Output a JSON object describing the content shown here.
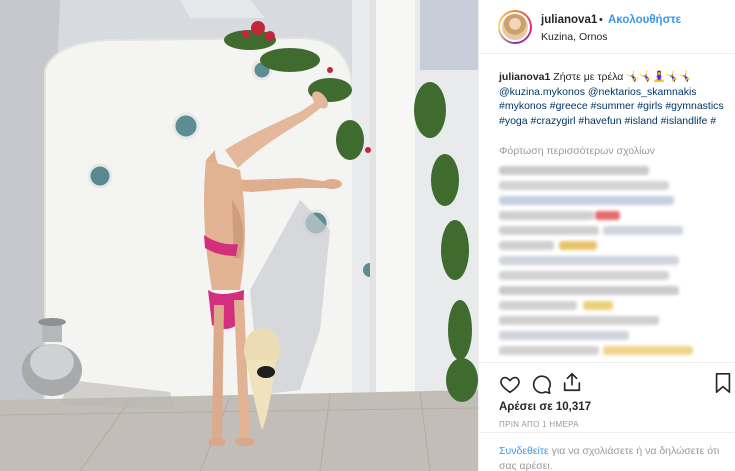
{
  "post": {
    "username": "julianova1",
    "separator": "•",
    "follow_label": "Ακολουθήστε",
    "location": "Kuzina, Ornos"
  },
  "caption": {
    "username": "julianova1",
    "text": "Ζήστε με τρέλα",
    "emoji": "🤸‍♀️🤸‍♀️🧘‍♀️🤸‍♀️🤸‍♀️",
    "mentions": "@kuzina.mykonos @nektarios_skamnakis",
    "hashtags": "#mykonos #greece #summer #girls #gymnastics #yoga #crazygirl #havefun #island #islandlife #"
  },
  "comments": {
    "load_more": "Φόρτωση περισσότερων σχολίων"
  },
  "actions": {
    "like_icon": "heart-icon",
    "comment_icon": "comment-icon",
    "share_icon": "share-icon",
    "save_icon": "bookmark-icon",
    "likes_text": "Αρέσει σε 10,317",
    "time_text": "ΠΡΙΝ ΑΠΟ 1 ΗΜΕΡΑ"
  },
  "login": {
    "link": "Συνδεθείτε",
    "rest": " για να σχολιάσετε ή να δηλώσετε ότι σας αρέσει."
  },
  "colors": {
    "accent": "#3897f0",
    "link_dark": "#003569",
    "muted": "#999999",
    "text": "#262626",
    "border": "#efefef"
  }
}
